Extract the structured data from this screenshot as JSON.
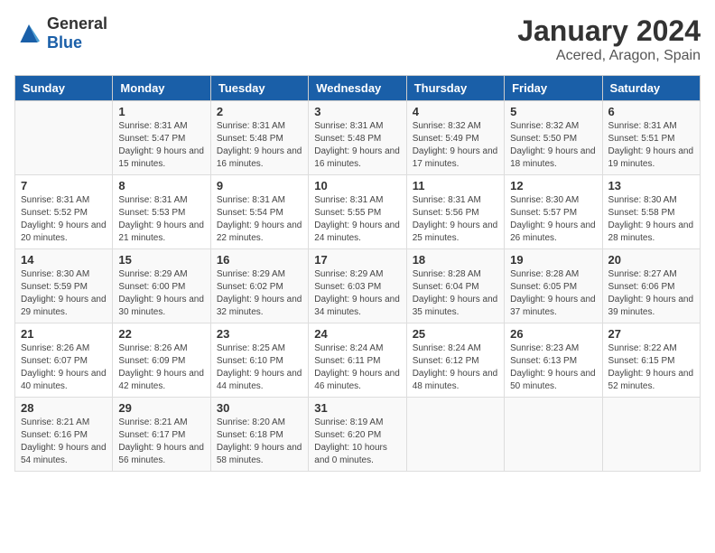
{
  "logo": {
    "general": "General",
    "blue": "Blue"
  },
  "title": "January 2024",
  "subtitle": "Acered, Aragon, Spain",
  "weekdays": [
    "Sunday",
    "Monday",
    "Tuesday",
    "Wednesday",
    "Thursday",
    "Friday",
    "Saturday"
  ],
  "weeks": [
    [
      {
        "day": null
      },
      {
        "day": "1",
        "sunrise": "Sunrise: 8:31 AM",
        "sunset": "Sunset: 5:47 PM",
        "daylight": "Daylight: 9 hours and 15 minutes."
      },
      {
        "day": "2",
        "sunrise": "Sunrise: 8:31 AM",
        "sunset": "Sunset: 5:48 PM",
        "daylight": "Daylight: 9 hours and 16 minutes."
      },
      {
        "day": "3",
        "sunrise": "Sunrise: 8:31 AM",
        "sunset": "Sunset: 5:48 PM",
        "daylight": "Daylight: 9 hours and 16 minutes."
      },
      {
        "day": "4",
        "sunrise": "Sunrise: 8:32 AM",
        "sunset": "Sunset: 5:49 PM",
        "daylight": "Daylight: 9 hours and 17 minutes."
      },
      {
        "day": "5",
        "sunrise": "Sunrise: 8:32 AM",
        "sunset": "Sunset: 5:50 PM",
        "daylight": "Daylight: 9 hours and 18 minutes."
      },
      {
        "day": "6",
        "sunrise": "Sunrise: 8:31 AM",
        "sunset": "Sunset: 5:51 PM",
        "daylight": "Daylight: 9 hours and 19 minutes."
      }
    ],
    [
      {
        "day": "7",
        "sunrise": "Sunrise: 8:31 AM",
        "sunset": "Sunset: 5:52 PM",
        "daylight": "Daylight: 9 hours and 20 minutes."
      },
      {
        "day": "8",
        "sunrise": "Sunrise: 8:31 AM",
        "sunset": "Sunset: 5:53 PM",
        "daylight": "Daylight: 9 hours and 21 minutes."
      },
      {
        "day": "9",
        "sunrise": "Sunrise: 8:31 AM",
        "sunset": "Sunset: 5:54 PM",
        "daylight": "Daylight: 9 hours and 22 minutes."
      },
      {
        "day": "10",
        "sunrise": "Sunrise: 8:31 AM",
        "sunset": "Sunset: 5:55 PM",
        "daylight": "Daylight: 9 hours and 24 minutes."
      },
      {
        "day": "11",
        "sunrise": "Sunrise: 8:31 AM",
        "sunset": "Sunset: 5:56 PM",
        "daylight": "Daylight: 9 hours and 25 minutes."
      },
      {
        "day": "12",
        "sunrise": "Sunrise: 8:30 AM",
        "sunset": "Sunset: 5:57 PM",
        "daylight": "Daylight: 9 hours and 26 minutes."
      },
      {
        "day": "13",
        "sunrise": "Sunrise: 8:30 AM",
        "sunset": "Sunset: 5:58 PM",
        "daylight": "Daylight: 9 hours and 28 minutes."
      }
    ],
    [
      {
        "day": "14",
        "sunrise": "Sunrise: 8:30 AM",
        "sunset": "Sunset: 5:59 PM",
        "daylight": "Daylight: 9 hours and 29 minutes."
      },
      {
        "day": "15",
        "sunrise": "Sunrise: 8:29 AM",
        "sunset": "Sunset: 6:00 PM",
        "daylight": "Daylight: 9 hours and 30 minutes."
      },
      {
        "day": "16",
        "sunrise": "Sunrise: 8:29 AM",
        "sunset": "Sunset: 6:02 PM",
        "daylight": "Daylight: 9 hours and 32 minutes."
      },
      {
        "day": "17",
        "sunrise": "Sunrise: 8:29 AM",
        "sunset": "Sunset: 6:03 PM",
        "daylight": "Daylight: 9 hours and 34 minutes."
      },
      {
        "day": "18",
        "sunrise": "Sunrise: 8:28 AM",
        "sunset": "Sunset: 6:04 PM",
        "daylight": "Daylight: 9 hours and 35 minutes."
      },
      {
        "day": "19",
        "sunrise": "Sunrise: 8:28 AM",
        "sunset": "Sunset: 6:05 PM",
        "daylight": "Daylight: 9 hours and 37 minutes."
      },
      {
        "day": "20",
        "sunrise": "Sunrise: 8:27 AM",
        "sunset": "Sunset: 6:06 PM",
        "daylight": "Daylight: 9 hours and 39 minutes."
      }
    ],
    [
      {
        "day": "21",
        "sunrise": "Sunrise: 8:26 AM",
        "sunset": "Sunset: 6:07 PM",
        "daylight": "Daylight: 9 hours and 40 minutes."
      },
      {
        "day": "22",
        "sunrise": "Sunrise: 8:26 AM",
        "sunset": "Sunset: 6:09 PM",
        "daylight": "Daylight: 9 hours and 42 minutes."
      },
      {
        "day": "23",
        "sunrise": "Sunrise: 8:25 AM",
        "sunset": "Sunset: 6:10 PM",
        "daylight": "Daylight: 9 hours and 44 minutes."
      },
      {
        "day": "24",
        "sunrise": "Sunrise: 8:24 AM",
        "sunset": "Sunset: 6:11 PM",
        "daylight": "Daylight: 9 hours and 46 minutes."
      },
      {
        "day": "25",
        "sunrise": "Sunrise: 8:24 AM",
        "sunset": "Sunset: 6:12 PM",
        "daylight": "Daylight: 9 hours and 48 minutes."
      },
      {
        "day": "26",
        "sunrise": "Sunrise: 8:23 AM",
        "sunset": "Sunset: 6:13 PM",
        "daylight": "Daylight: 9 hours and 50 minutes."
      },
      {
        "day": "27",
        "sunrise": "Sunrise: 8:22 AM",
        "sunset": "Sunset: 6:15 PM",
        "daylight": "Daylight: 9 hours and 52 minutes."
      }
    ],
    [
      {
        "day": "28",
        "sunrise": "Sunrise: 8:21 AM",
        "sunset": "Sunset: 6:16 PM",
        "daylight": "Daylight: 9 hours and 54 minutes."
      },
      {
        "day": "29",
        "sunrise": "Sunrise: 8:21 AM",
        "sunset": "Sunset: 6:17 PM",
        "daylight": "Daylight: 9 hours and 56 minutes."
      },
      {
        "day": "30",
        "sunrise": "Sunrise: 8:20 AM",
        "sunset": "Sunset: 6:18 PM",
        "daylight": "Daylight: 9 hours and 58 minutes."
      },
      {
        "day": "31",
        "sunrise": "Sunrise: 8:19 AM",
        "sunset": "Sunset: 6:20 PM",
        "daylight": "Daylight: 10 hours and 0 minutes."
      },
      {
        "day": null
      },
      {
        "day": null
      },
      {
        "day": null
      }
    ]
  ]
}
